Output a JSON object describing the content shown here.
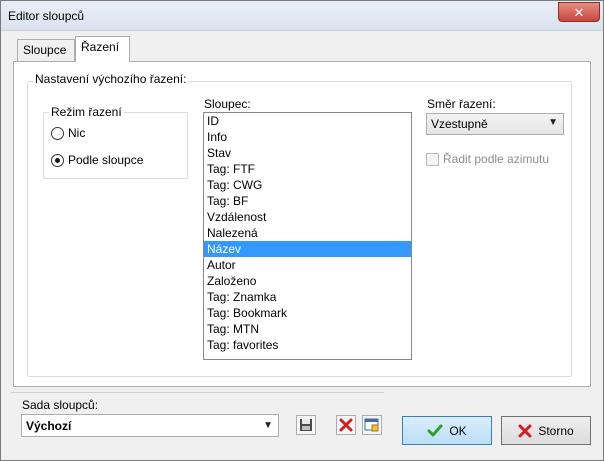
{
  "window": {
    "title": "Editor sloupců",
    "close": "✕"
  },
  "tabs": [
    {
      "label": "Sloupce"
    },
    {
      "label": "Řazení"
    }
  ],
  "default_sort_group": {
    "legend": "Nastavení výchozího řazení:"
  },
  "mode_group": {
    "legend": "Režim řazení",
    "options": [
      {
        "label": "Nic"
      },
      {
        "label": "Podle sloupce"
      }
    ]
  },
  "column": {
    "label": "Sloupec:",
    "items": [
      "ID",
      "Info",
      "Stav",
      "Tag: FTF",
      "Tag: CWG",
      "Tag: BF",
      "Vzdálenost",
      "Nalezená",
      "Název",
      "Autor",
      "Založeno",
      "Tag: Znamka",
      "Tag: Bookmark",
      "Tag: MTN",
      "Tag: favorites"
    ],
    "selected": "Název"
  },
  "direction": {
    "label": "Směr řazení:",
    "value": "Vzestupně",
    "azimuth_label": "Řadit podle azimutu"
  },
  "column_set": {
    "label": "Sada sloupců:",
    "value": "Výchozí"
  },
  "buttons": {
    "ok": "OK",
    "cancel": "Storno"
  }
}
